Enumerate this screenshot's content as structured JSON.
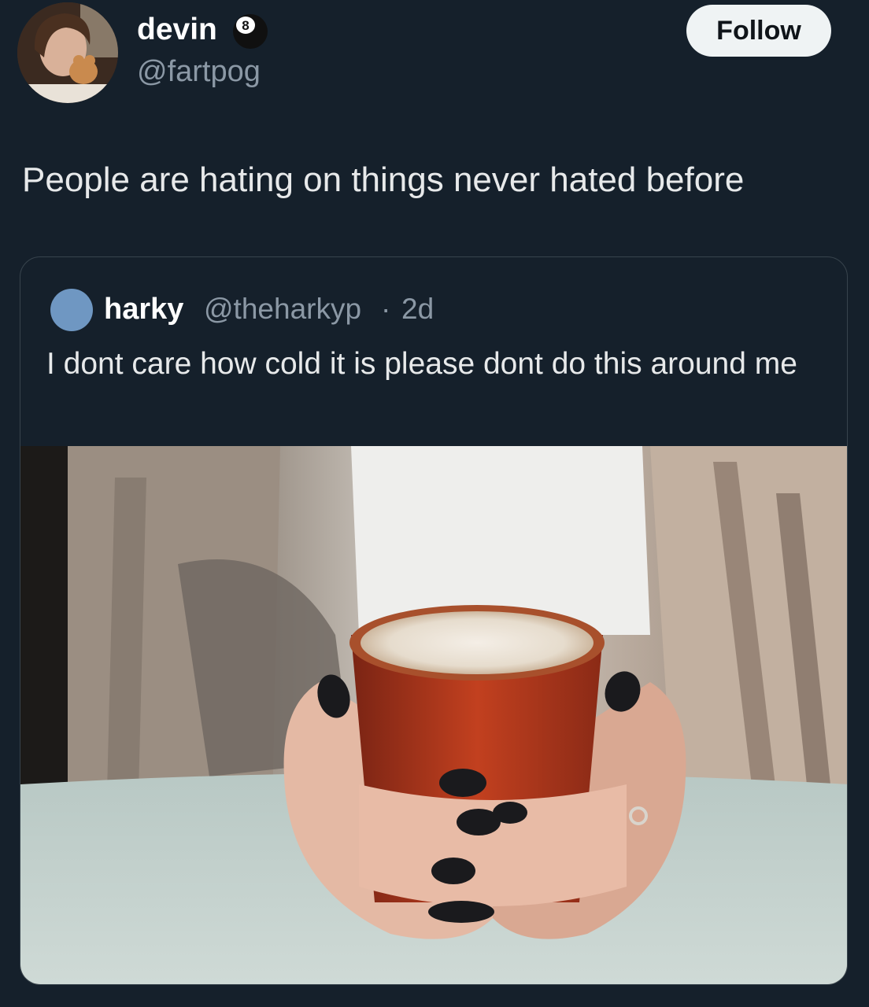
{
  "author": {
    "name": "devin",
    "handle": "@fartpog",
    "badge_icon": "eight-ball-icon",
    "badge_number": "8"
  },
  "follow_label": "Follow",
  "tweet_text": "People are hating on things never hated before",
  "quoted_tweet": {
    "name": "harky",
    "handle": "@theharkyp",
    "separator": "·",
    "time": "2d",
    "text": "I dont care how cold it is please dont do this around me",
    "avatar_color": "#6f97c2"
  },
  "colors": {
    "background": "#15202b",
    "border": "#38444d",
    "secondary_text": "#8b98a5",
    "follow_button_bg": "#eff3f4"
  }
}
